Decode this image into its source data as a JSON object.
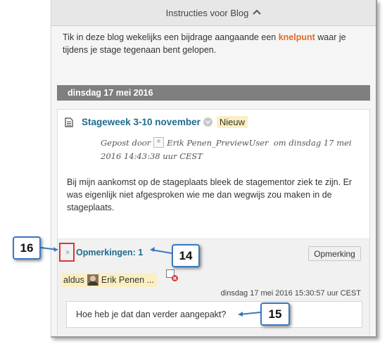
{
  "instructions": {
    "header_label": "Instructies voor Blog",
    "text_before": "Tik in deze blog wekelijks een bijdrage aangaande een ",
    "highlight": "knelpunt",
    "text_after": " waar je tijdens je stage tegenaan bent gelopen."
  },
  "date_header": "dinsdag 17 mei 2016",
  "entry": {
    "title": "Stageweek 3-10 november",
    "badge": "Nieuw",
    "posted_by_prefix": "Gepost door",
    "author": "Erik Penen_PreviewUser",
    "posted_on": "om dinsdag 17 mei 2016 14:43:38 uur CEST",
    "body": "Bij mijn aankomst op de stageplaats bleek de stagementor ziek te zijn. Er was eigenlijk niet afgesproken wie me dan wegwijs zou maken in de stageplaats."
  },
  "comments": {
    "toggle_glyph": "»",
    "link_label": "Opmerkingen: 1",
    "button_label": "Opmerking",
    "items": [
      {
        "prefix": "aldus",
        "author": "Erik Penen ...",
        "date": "dinsdag 17 mei 2016 15:30:57 uur CEST",
        "text": "Hoe heb je dat dan verder aangepakt?"
      }
    ]
  },
  "callouts": {
    "toggle": "16",
    "comments_link": "14",
    "comment_text": "15"
  },
  "colors": {
    "link": "#1f6b8b",
    "highlight": "#e56b1f",
    "badge_bg": "#fbefc2",
    "date_bar": "#7f7f7f",
    "callout_border": "#3c78c3",
    "marker_red": "#d6383a"
  },
  "icons": {
    "collapse": "chevron-up-icon",
    "entry": "document-icon",
    "status": "status-circle-icon",
    "delete": "delete-comment-icon",
    "avatar": "user-avatar"
  }
}
